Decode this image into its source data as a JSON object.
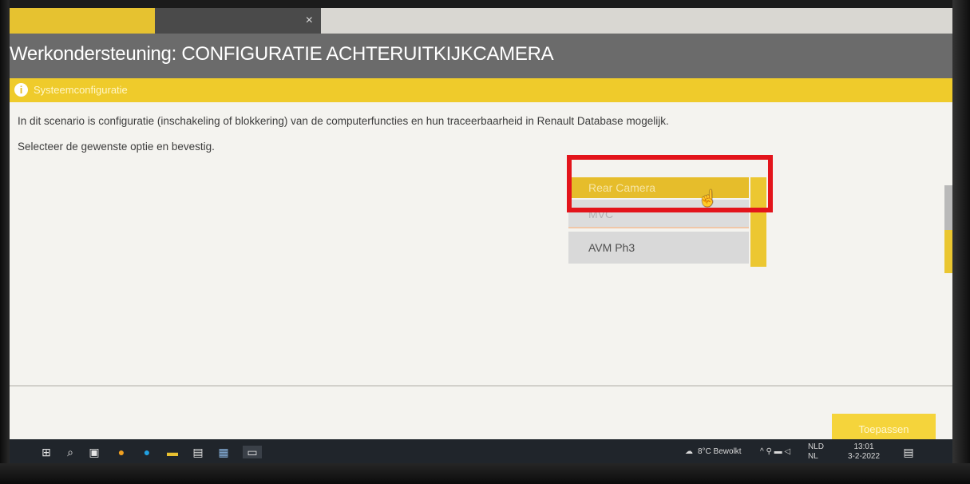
{
  "window": {
    "title": "Werkondersteuning: CONFIGURATIE ACHTERUITKIJKCAMERA"
  },
  "section": {
    "label": "Systeemconfiguratie"
  },
  "content": {
    "description": "In dit scenario is configuratie (inschakeling of blokkering) van de computerfuncties en hun traceerbaarheid in Renault Database mogelijk.",
    "instruction": "Selecteer de gewenste optie en bevestig."
  },
  "options": [
    {
      "label": "Rear Camera",
      "selected": true
    },
    {
      "label": "MVC",
      "selected": false
    },
    {
      "label": "AVM Ph3",
      "selected": false
    }
  ],
  "actions": {
    "apply_label": "Toepassen"
  },
  "taskbar": {
    "weather": "8°C Bewolkt",
    "language": "NLD",
    "region": "NL",
    "time": "13:01",
    "date": "3-2-2022"
  },
  "colors": {
    "accent_yellow": "#efcb2b",
    "title_gray": "#6b6b6b",
    "highlight_red": "#e3141b"
  },
  "icons": {
    "section": "info-icon",
    "cursor": "hand-pointer-icon"
  }
}
